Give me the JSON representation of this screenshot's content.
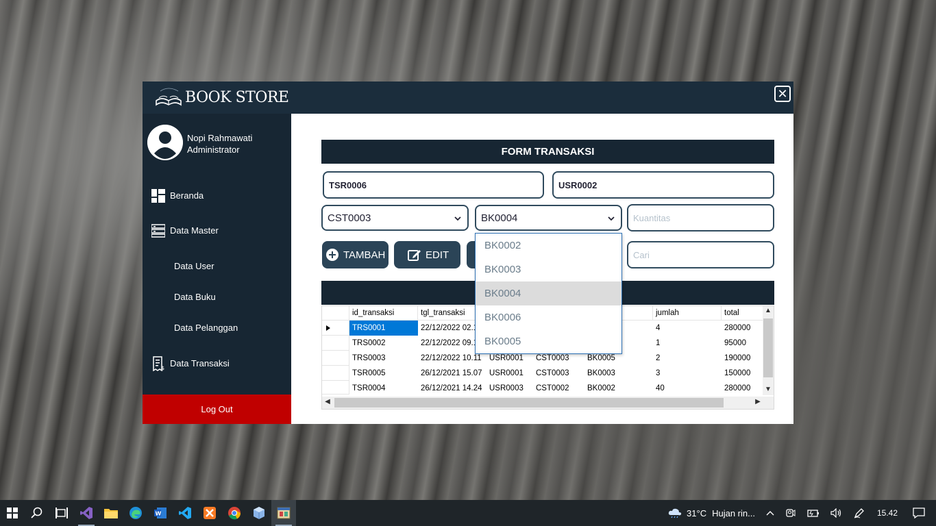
{
  "app": {
    "title": "BOOK STORE",
    "logo_small_text": "BOOK STORE",
    "close_glyph": "✕"
  },
  "user": {
    "name": "Nopi Rahmawati",
    "role": "Administrator"
  },
  "sidebar": {
    "items": [
      {
        "label": "Beranda",
        "icon": "dashboard-icon"
      },
      {
        "label": "Data Master",
        "icon": "server-icon"
      },
      {
        "label": "Data User"
      },
      {
        "label": "Data Buku"
      },
      {
        "label": "Data Pelanggan"
      },
      {
        "label": "Data Transaksi",
        "icon": "invoice-icon"
      }
    ],
    "logout_label": "Log Out"
  },
  "form": {
    "header": "FORM TRANSAKSI",
    "id_transaksi": "TSR0006",
    "id_user": "USR0002",
    "customer_select": "CST0003",
    "book_select": "BK0004",
    "quantity_placeholder": "Kuantitas",
    "search_placeholder": "Cari",
    "buttons": {
      "tambah": "TAMBAH",
      "edit": "EDIT"
    }
  },
  "dropdown": {
    "options": [
      "BK0002",
      "BK0003",
      "BK0004",
      "BK0006",
      "BK0005"
    ],
    "highlighted": "BK0004"
  },
  "table": {
    "columns": [
      "id_transaksi",
      "tgl_transaksi",
      "",
      "",
      "",
      "jumlah",
      "total"
    ],
    "rows": [
      [
        "TRS0001",
        "22/12/2022 02.1",
        "",
        "",
        "",
        "4",
        "280000"
      ],
      [
        "TRS0002",
        "22/12/2022 09.1",
        "",
        "",
        "",
        "1",
        "95000"
      ],
      [
        "TRS0003",
        "22/12/2022 10.11",
        "USR0001",
        "CST0003",
        "BK0005",
        "2",
        "190000"
      ],
      [
        "TSR0005",
        "26/12/2021 15.07",
        "USR0001",
        "CST0003",
        "BK0003",
        "3",
        "150000"
      ],
      [
        "TSR0004",
        "26/12/2021 14.24",
        "USR0003",
        "CST0002",
        "BK0002",
        "40",
        "280000"
      ]
    ]
  },
  "taskbar": {
    "weather_temp": "31°C",
    "weather_text": "Hujan rin...",
    "clock": "15.42"
  },
  "colors": {
    "navy": "#172633",
    "titlebar": "#1b2d3c",
    "button": "#2b4457",
    "logout": "#c00000",
    "selection": "#0078d7"
  }
}
